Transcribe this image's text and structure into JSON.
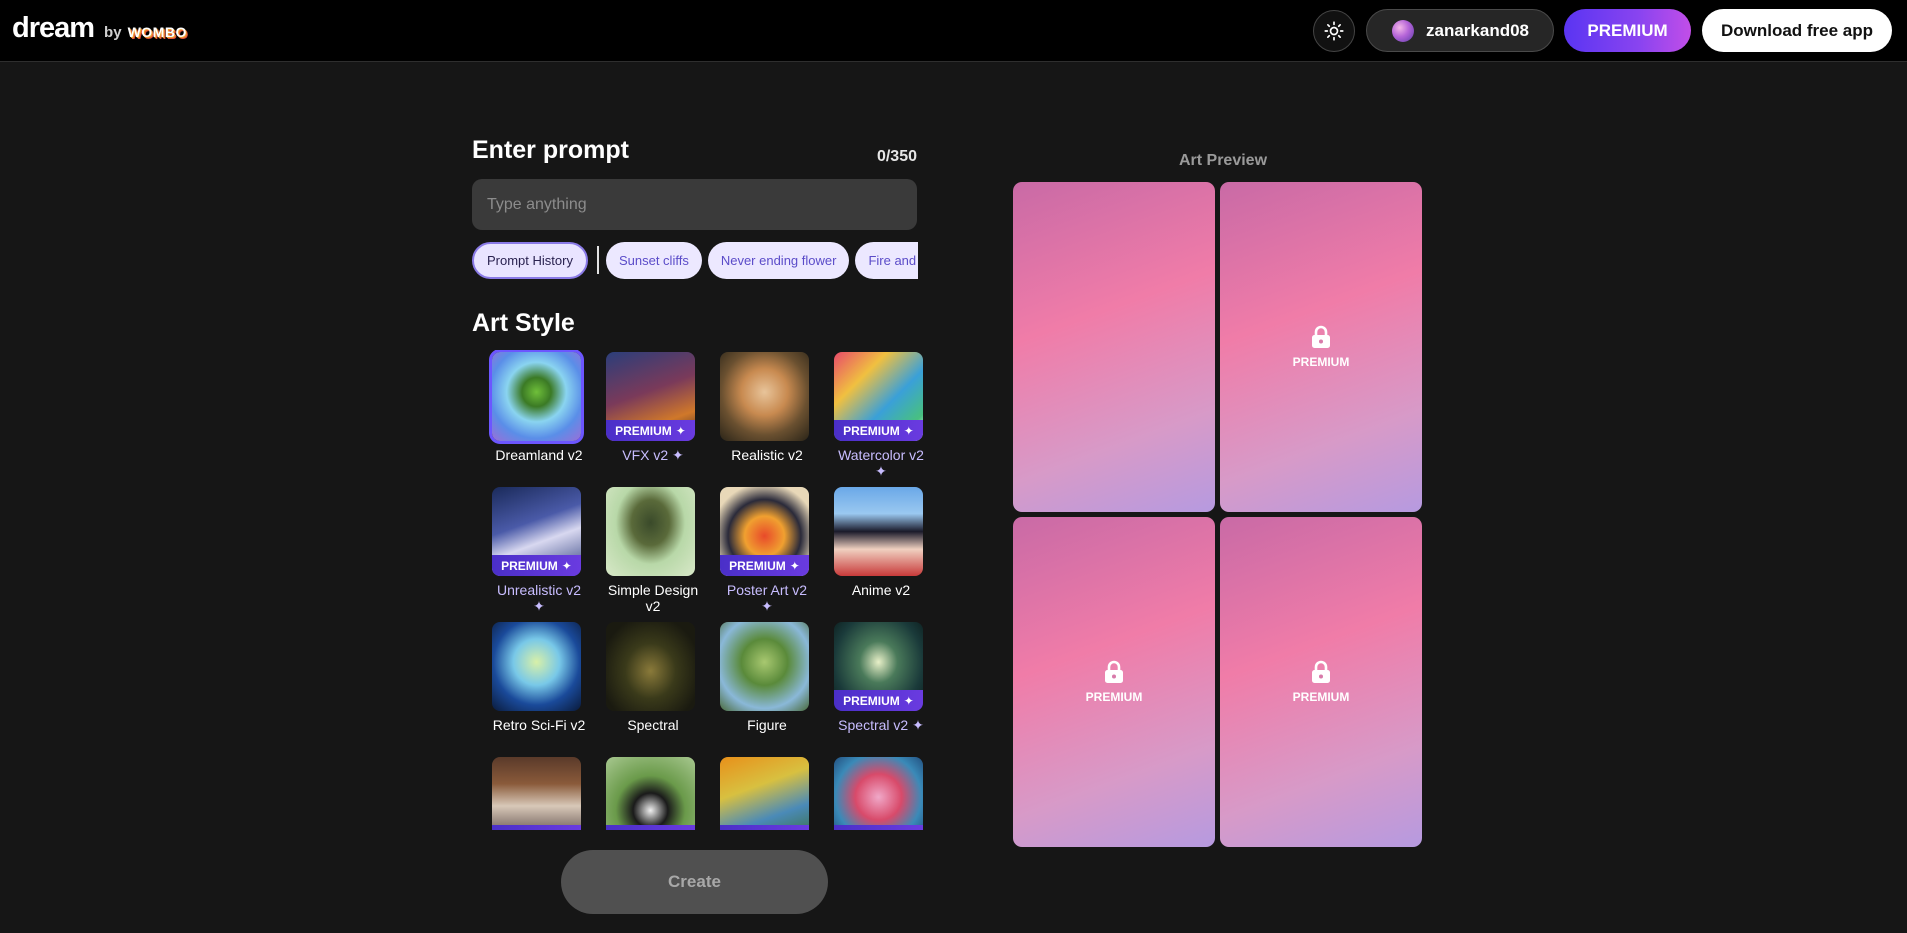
{
  "header": {
    "logo_dream": "dream",
    "logo_by": "by",
    "logo_wombo": "WOMBO",
    "username": "zanarkand08",
    "premium_label": "PREMIUM",
    "download_label": "Download free app"
  },
  "prompt": {
    "title": "Enter prompt",
    "char_count": "0/350",
    "placeholder": "Type anything",
    "value": ""
  },
  "chips": {
    "history_label": "Prompt History",
    "suggestions": [
      "Sunset cliffs",
      "Never ending flower",
      "Fire and water"
    ]
  },
  "art_style": {
    "title": "Art Style",
    "badge_label": "PREMIUM",
    "items": [
      {
        "label": "Dreamland v2",
        "premium": false,
        "selected": true
      },
      {
        "label": "VFX v2",
        "premium": true,
        "selected": false
      },
      {
        "label": "Realistic v2",
        "premium": false,
        "selected": false
      },
      {
        "label": "Watercolor v2",
        "premium": true,
        "selected": false
      },
      {
        "label": "Unrealistic v2",
        "premium": true,
        "selected": false
      },
      {
        "label": "Simple Design v2",
        "premium": false,
        "selected": false
      },
      {
        "label": "Poster Art v2",
        "premium": true,
        "selected": false
      },
      {
        "label": "Anime v2",
        "premium": false,
        "selected": false
      },
      {
        "label": "Retro Sci-Fi v2",
        "premium": false,
        "selected": false
      },
      {
        "label": "Spectral",
        "premium": false,
        "selected": false
      },
      {
        "label": "Figure",
        "premium": false,
        "selected": false
      },
      {
        "label": "Spectral v2",
        "premium": true,
        "selected": false
      },
      {
        "label": "",
        "premium": true,
        "selected": false
      },
      {
        "label": "",
        "premium": true,
        "selected": false
      },
      {
        "label": "",
        "premium": true,
        "selected": false
      },
      {
        "label": "",
        "premium": true,
        "selected": false
      }
    ]
  },
  "create_label": "Create",
  "preview": {
    "title": "Art Preview",
    "cards": [
      {
        "locked": false,
        "label": ""
      },
      {
        "locked": true,
        "label": "PREMIUM"
      },
      {
        "locked": true,
        "label": "PREMIUM"
      },
      {
        "locked": true,
        "label": "PREMIUM"
      }
    ]
  }
}
